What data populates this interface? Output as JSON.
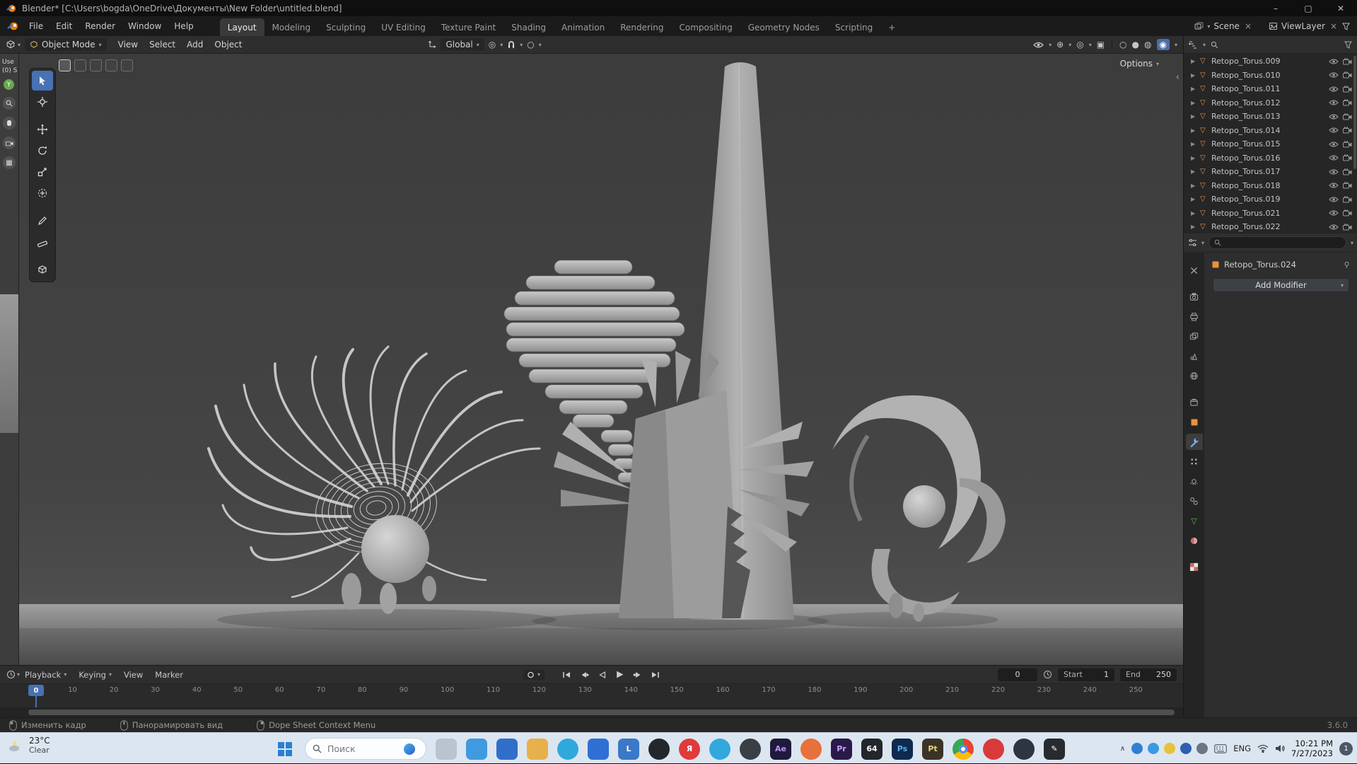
{
  "window": {
    "title": "Blender* [C:\\Users\\bogda\\OneDrive\\Документы\\New Folder\\untitled.blend]"
  },
  "topbar": {
    "menus": [
      {
        "label": "File"
      },
      {
        "label": "Edit"
      },
      {
        "label": "Render"
      },
      {
        "label": "Window"
      },
      {
        "label": "Help"
      }
    ],
    "tabs": [
      {
        "label": "Layout",
        "active": true
      },
      {
        "label": "Modeling"
      },
      {
        "label": "Sculpting"
      },
      {
        "label": "UV Editing"
      },
      {
        "label": "Texture Paint"
      },
      {
        "label": "Shading"
      },
      {
        "label": "Animation"
      },
      {
        "label": "Rendering"
      },
      {
        "label": "Compositing"
      },
      {
        "label": "Geometry Nodes"
      },
      {
        "label": "Scripting"
      },
      {
        "label": "+"
      }
    ],
    "scene_label": "Scene",
    "viewlayer_label": "ViewLayer"
  },
  "viewport": {
    "mode": "Object Mode",
    "menus": [
      {
        "label": "View"
      },
      {
        "label": "Select"
      },
      {
        "label": "Add"
      },
      {
        "label": "Object"
      }
    ],
    "orientation": "Global",
    "options_label": "Options",
    "overlay": {
      "corner_text_1": "Use",
      "corner_text_2": "(0) S",
      "axis_y": "Y"
    }
  },
  "outliner": {
    "items": [
      {
        "label": "Retopo_Torus.009"
      },
      {
        "label": "Retopo_Torus.010"
      },
      {
        "label": "Retopo_Torus.011"
      },
      {
        "label": "Retopo_Torus.012"
      },
      {
        "label": "Retopo_Torus.013"
      },
      {
        "label": "Retopo_Torus.014"
      },
      {
        "label": "Retopo_Torus.015"
      },
      {
        "label": "Retopo_Torus.016"
      },
      {
        "label": "Retopo_Torus.017"
      },
      {
        "label": "Retopo_Torus.018"
      },
      {
        "label": "Retopo_Torus.019"
      },
      {
        "label": "Retopo_Torus.021"
      },
      {
        "label": "Retopo_Torus.022"
      }
    ]
  },
  "properties": {
    "breadcrumb": "Retopo_Torus.024",
    "add_modifier": "Add Modifier"
  },
  "timeline": {
    "menus": [
      {
        "label": "Playback",
        "caret": true
      },
      {
        "label": "Keying",
        "caret": true
      },
      {
        "label": "View"
      },
      {
        "label": "Marker"
      }
    ],
    "frame": "0",
    "start_label": "Start",
    "start_value": "1",
    "end_label": "End",
    "end_value": "250",
    "playhead": "0",
    "ticks": [
      "0",
      "10",
      "20",
      "30",
      "40",
      "50",
      "60",
      "70",
      "80",
      "90",
      "100",
      "110",
      "120",
      "130",
      "140",
      "150",
      "160",
      "170",
      "180",
      "190",
      "200",
      "210",
      "220",
      "230",
      "240",
      "250"
    ]
  },
  "status": {
    "hints": [
      {
        "label": "Изменить кадр",
        "left": true
      },
      {
        "label": "Панорамировать вид",
        "middle": true
      },
      {
        "label": "Dope Sheet Context Menu",
        "right": true
      }
    ],
    "version": "3.6.0"
  },
  "taskbar": {
    "weather_temp": "23°C",
    "weather_cond": "Clear",
    "search_placeholder": "Поиск",
    "apps": [
      {
        "name": "widgets-building",
        "color": "#b9c4cf",
        "letter": ""
      },
      {
        "name": "file-explorer",
        "color": "#3f9ae0",
        "letter": ""
      },
      {
        "name": "camera-app",
        "color": "#2f6fc9",
        "letter": ""
      },
      {
        "name": "folder-app",
        "color": "#e8b04a",
        "letter": ""
      },
      {
        "name": "edge-browser",
        "color": "#2fa8dc",
        "circle": true
      },
      {
        "name": "microsoft-store",
        "color": "#2f6fd4",
        "letter": ""
      },
      {
        "name": "libreoffice",
        "color": "#3a78c8",
        "letter": "L"
      },
      {
        "name": "xbox",
        "color": "#23272b",
        "circle": true
      },
      {
        "name": "yandex-browser",
        "color": "#e03a3a",
        "circle": true,
        "letter": "Я"
      },
      {
        "name": "telegram",
        "color": "#32a8dc",
        "circle": true
      },
      {
        "name": "dark-app",
        "color": "#3a3f46",
        "circle": true
      },
      {
        "name": "after-effects",
        "color": "#1f1a3d",
        "letter": "Ae",
        "letter_color": "#b49af0"
      },
      {
        "name": "firefox",
        "color": "#e8703a",
        "circle": true
      },
      {
        "name": "premiere-pro",
        "color": "#2a1a4a",
        "letter": "Pr",
        "letter_color": "#c9a3f5"
      },
      {
        "name": "app-64",
        "color": "#23272b",
        "letter": "64"
      },
      {
        "name": "photoshop",
        "color": "#0f2a4f",
        "letter": "Ps",
        "letter_color": "#5ab0f0"
      },
      {
        "name": "paint-tool",
        "color": "#3a3426",
        "letter": "Pt",
        "letter_color": "#e8d27a"
      },
      {
        "name": "chrome",
        "color": "chrome",
        "circle": true
      },
      {
        "name": "opera",
        "color": "#d83a3a",
        "circle": true
      },
      {
        "name": "media-app",
        "color": "#2f3540",
        "circle": true
      },
      {
        "name": "pen-app",
        "color": "#272b30",
        "letter": "✎"
      }
    ],
    "tray_dots": [
      {
        "color": "#2f7fd4"
      },
      {
        "color": "#3a9ae0"
      },
      {
        "color": "#e8c23a"
      },
      {
        "color": "#2f5fb0"
      },
      {
        "color": "#6a7684"
      }
    ],
    "tray_lang": "ENG",
    "time": "10:21 PM",
    "date": "7/27/2023",
    "badge": "1"
  }
}
